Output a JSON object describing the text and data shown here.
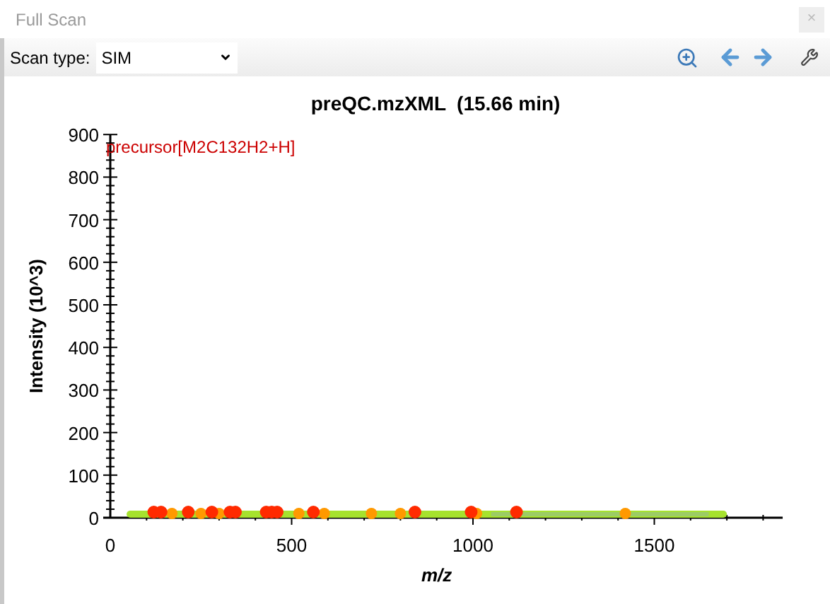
{
  "window": {
    "title": "Full Scan",
    "close": "×"
  },
  "toolbar": {
    "label": "Scan type:",
    "scan_type": "SIM"
  },
  "chart": {
    "chart_data": {
      "type": "scatter",
      "title": "preQC.mzXML  (15.66 min)",
      "xlabel": "m/z",
      "ylabel": "Intensity (10^3)",
      "xlim": [
        0,
        1850
      ],
      "ylim": [
        0,
        900
      ],
      "xticks": [
        0,
        500,
        1000,
        1500
      ],
      "yticks": [
        0,
        100,
        200,
        300,
        400,
        500,
        600,
        700,
        800,
        900
      ],
      "annotations": [
        "precursor[M2C132H2+H]"
      ]
    }
  }
}
